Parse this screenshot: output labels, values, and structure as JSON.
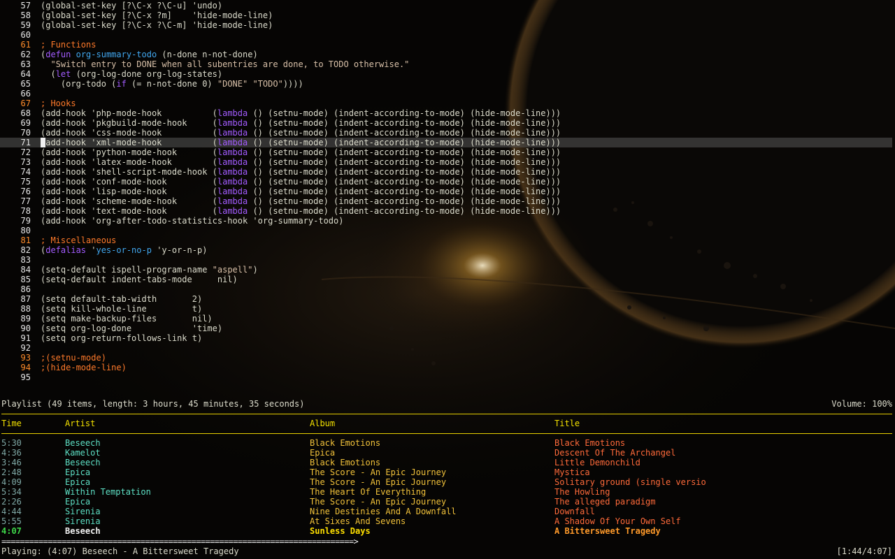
{
  "editor": {
    "lines": [
      {
        "n": "57",
        "tokens": [
          [
            "plain",
            "(global-set-key [?\\C-x ?\\C-u] 'undo)"
          ]
        ]
      },
      {
        "n": "58",
        "tokens": [
          [
            "plain",
            "(global-set-key [?\\C-x ?m]    'hide-mode-line)"
          ]
        ]
      },
      {
        "n": "59",
        "tokens": [
          [
            "plain",
            "(global-set-key [?\\C-x ?\\C-m] 'hide-mode-line)"
          ]
        ]
      },
      {
        "n": "60",
        "tokens": []
      },
      {
        "n": "61",
        "hl": true,
        "tokens": [
          [
            "comment",
            "; Functions"
          ]
        ]
      },
      {
        "n": "62",
        "tokens": [
          [
            "plain",
            "("
          ],
          [
            "kw",
            "defun"
          ],
          [
            "plain",
            " "
          ],
          [
            "fn",
            "org-summary-todo"
          ],
          [
            "plain",
            " (n-done n-not-done)"
          ]
        ]
      },
      {
        "n": "63",
        "tokens": [
          [
            "str",
            "  \"Switch entry to DONE when all subentries are done, to TODO otherwise.\""
          ]
        ]
      },
      {
        "n": "64",
        "tokens": [
          [
            "plain",
            "  ("
          ],
          [
            "kw",
            "let"
          ],
          [
            "plain",
            " (org-log-done org-log-states)"
          ]
        ]
      },
      {
        "n": "65",
        "tokens": [
          [
            "plain",
            "    (org-todo ("
          ],
          [
            "kw",
            "if"
          ],
          [
            "plain",
            " (= n-not-done 0) "
          ],
          [
            "str",
            "\"DONE\""
          ],
          [
            "plain",
            " "
          ],
          [
            "str",
            "\"TODO\""
          ],
          [
            "plain",
            "))))"
          ]
        ]
      },
      {
        "n": "66",
        "tokens": []
      },
      {
        "n": "67",
        "hl": true,
        "tokens": [
          [
            "comment",
            "; Hooks"
          ]
        ]
      },
      {
        "n": "68",
        "tokens": [
          [
            "plain",
            "(add-hook 'php-mode-hook          ("
          ],
          [
            "kw",
            "lambda"
          ],
          [
            "plain",
            " () (setnu-mode) (indent-according-to-mode) (hide-mode-line)))"
          ]
        ]
      },
      {
        "n": "69",
        "tokens": [
          [
            "plain",
            "(add-hook 'pkgbuild-mode-hook     ("
          ],
          [
            "kw",
            "lambda"
          ],
          [
            "plain",
            " () (setnu-mode) (indent-according-to-mode) (hide-mode-line)))"
          ]
        ]
      },
      {
        "n": "70",
        "tokens": [
          [
            "plain",
            "(add-hook 'css-mode-hook          ("
          ],
          [
            "kw",
            "lambda"
          ],
          [
            "plain",
            " () (setnu-mode) (indent-according-to-mode) (hide-mode-line)))"
          ]
        ]
      },
      {
        "n": "71",
        "current": true,
        "tokens": [
          [
            "plain",
            "(add-hook 'xml-mode-hook          ("
          ],
          [
            "kw",
            "lambda"
          ],
          [
            "plain",
            " () (setnu-mode) (indent-according-to-mode) (hide-mode-line)))"
          ]
        ]
      },
      {
        "n": "72",
        "tokens": [
          [
            "plain",
            "(add-hook 'python-mode-hook       ("
          ],
          [
            "kw",
            "lambda"
          ],
          [
            "plain",
            " () (setnu-mode) (indent-according-to-mode) (hide-mode-line)))"
          ]
        ]
      },
      {
        "n": "73",
        "tokens": [
          [
            "plain",
            "(add-hook 'latex-mode-hook        ("
          ],
          [
            "kw",
            "lambda"
          ],
          [
            "plain",
            " () (setnu-mode) (indent-according-to-mode) (hide-mode-line)))"
          ]
        ]
      },
      {
        "n": "74",
        "tokens": [
          [
            "plain",
            "(add-hook 'shell-script-mode-hook ("
          ],
          [
            "kw",
            "lambda"
          ],
          [
            "plain",
            " () (setnu-mode) (indent-according-to-mode) (hide-mode-line)))"
          ]
        ]
      },
      {
        "n": "75",
        "tokens": [
          [
            "plain",
            "(add-hook 'conf-mode-hook         ("
          ],
          [
            "kw",
            "lambda"
          ],
          [
            "plain",
            " () (setnu-mode) (indent-according-to-mode) (hide-mode-line)))"
          ]
        ]
      },
      {
        "n": "76",
        "tokens": [
          [
            "plain",
            "(add-hook 'lisp-mode-hook         ("
          ],
          [
            "kw",
            "lambda"
          ],
          [
            "plain",
            " () (setnu-mode) (indent-according-to-mode) (hide-mode-line)))"
          ]
        ]
      },
      {
        "n": "77",
        "tokens": [
          [
            "plain",
            "(add-hook 'scheme-mode-hook       ("
          ],
          [
            "kw",
            "lambda"
          ],
          [
            "plain",
            " () (setnu-mode) (indent-according-to-mode) (hide-mode-line)))"
          ]
        ]
      },
      {
        "n": "78",
        "tokens": [
          [
            "plain",
            "(add-hook 'text-mode-hook         ("
          ],
          [
            "kw",
            "lambda"
          ],
          [
            "plain",
            " () (setnu-mode) (indent-according-to-mode) (hide-mode-line)))"
          ]
        ]
      },
      {
        "n": "79",
        "tokens": [
          [
            "plain",
            "(add-hook 'org-after-todo-statistics-hook 'org-summary-todo)"
          ]
        ]
      },
      {
        "n": "80",
        "tokens": []
      },
      {
        "n": "81",
        "hl": true,
        "tokens": [
          [
            "comment",
            "; Miscellaneous"
          ]
        ]
      },
      {
        "n": "82",
        "tokens": [
          [
            "plain",
            "("
          ],
          [
            "kw",
            "defalias"
          ],
          [
            "plain",
            " '"
          ],
          [
            "fn",
            "yes-or-no-p"
          ],
          [
            "plain",
            " 'y-or-n-p)"
          ]
        ]
      },
      {
        "n": "83",
        "tokens": []
      },
      {
        "n": "84",
        "tokens": [
          [
            "plain",
            "(setq-default ispell-program-name "
          ],
          [
            "str",
            "\"aspell\""
          ],
          [
            "plain",
            ")"
          ]
        ]
      },
      {
        "n": "85",
        "tokens": [
          [
            "plain",
            "(setq-default indent-tabs-mode     nil)"
          ]
        ]
      },
      {
        "n": "86",
        "tokens": []
      },
      {
        "n": "87",
        "tokens": [
          [
            "plain",
            "(setq default-tab-width       2)"
          ]
        ]
      },
      {
        "n": "88",
        "tokens": [
          [
            "plain",
            "(setq kill-whole-line         t)"
          ]
        ]
      },
      {
        "n": "89",
        "tokens": [
          [
            "plain",
            "(setq make-backup-files       nil)"
          ]
        ]
      },
      {
        "n": "90",
        "tokens": [
          [
            "plain",
            "(setq org-log-done            'time)"
          ]
        ]
      },
      {
        "n": "91",
        "tokens": [
          [
            "plain",
            "(setq org-return-follows-link t)"
          ]
        ]
      },
      {
        "n": "92",
        "tokens": []
      },
      {
        "n": "93",
        "hl": true,
        "tokens": [
          [
            "comment",
            ";(setnu-mode)"
          ]
        ]
      },
      {
        "n": "94",
        "hl": true,
        "tokens": [
          [
            "comment",
            ";(hide-mode-line)"
          ]
        ]
      },
      {
        "n": "95",
        "tokens": []
      }
    ]
  },
  "playlist": {
    "header": "Playlist (49 items, length: 3 hours, 45 minutes, 35 seconds)",
    "volume": "Volume: 100%",
    "columns": {
      "time": "Time",
      "artist": "Artist",
      "album": "Album",
      "title": "Title"
    },
    "rows": [
      {
        "time": "5:30",
        "artist": "Beseech",
        "album": "Black Emotions",
        "title": "Black Emotions"
      },
      {
        "time": "4:36",
        "artist": "Kamelot",
        "album": "Epica",
        "title": "Descent Of The Archangel"
      },
      {
        "time": "3:46",
        "artist": "Beseech",
        "album": "Black Emotions",
        "title": "Little Demonchild"
      },
      {
        "time": "2:48",
        "artist": "Epica",
        "album": "The Score - An Epic Journey",
        "title": "Mystica"
      },
      {
        "time": "4:09",
        "artist": "Epica",
        "album": "The Score - An Epic Journey",
        "title": "Solitary ground (single versio"
      },
      {
        "time": "5:34",
        "artist": "Within Temptation",
        "album": "The Heart Of Everything",
        "title": "The Howling"
      },
      {
        "time": "2:26",
        "artist": "Epica",
        "album": "The Score - An Epic Journey",
        "title": "The alleged paradigm"
      },
      {
        "time": "4:44",
        "artist": "Sirenia",
        "album": "Nine Destinies And A Downfall",
        "title": "Downfall"
      },
      {
        "time": "5:55",
        "artist": "Sirenia",
        "album": "At Sixes And Sevens",
        "title": "A Shadow Of Your Own Self"
      },
      {
        "time": "4:07",
        "artist": "Beseech",
        "album": "Sunless Days",
        "title": "A Bittersweet Tragedy",
        "playing": true
      }
    ]
  },
  "progress": {
    "bar": "============================================================================>",
    "fraction": 0.42
  },
  "status": {
    "prefix": "Playing:",
    "text": " (4:07) Beseech - A Bittersweet Tragedy",
    "time": "[1:44/4:07]"
  }
}
